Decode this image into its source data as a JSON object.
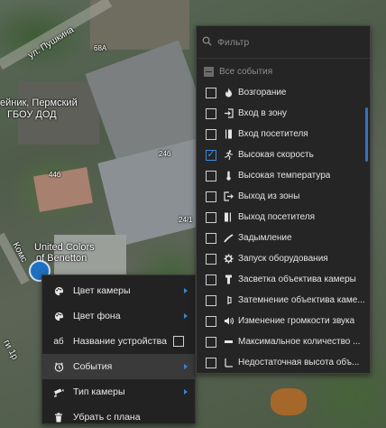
{
  "map": {
    "labels": {
      "street": "ул. Пушкина",
      "b68a": "68А",
      "school_line1": "ейник, Пермский",
      "school_line2": "ГБОУ ДОД",
      "b44b": "44б",
      "b24b": "24б",
      "b241": "24/1",
      "store_line1": "United Colors",
      "store_line2": "of Benetton",
      "side_street": "Комс",
      "side_bottom": "ги 1р"
    }
  },
  "context_menu": {
    "items": [
      {
        "id": "camera-color",
        "label": "Цвет камеры",
        "icon": "palette-icon",
        "submenu": true
      },
      {
        "id": "background-color",
        "label": "Цвет фона",
        "icon": "palette-icon",
        "submenu": true
      },
      {
        "id": "device-name",
        "label": "Название устройства",
        "icon": "text-icon",
        "icon_text": "аб",
        "checkbox": true,
        "checked": false
      },
      {
        "id": "events",
        "label": "События",
        "icon": "clock-icon",
        "submenu": true,
        "active": true
      },
      {
        "id": "camera-type",
        "label": "Тип камеры",
        "icon": "camera-icon",
        "submenu": true
      },
      {
        "id": "remove-from-plan",
        "label": "Убрать с плана",
        "icon": "trash-icon"
      }
    ]
  },
  "events_menu": {
    "filter_placeholder": "Фильтр",
    "all_label": "Все события",
    "items": [
      {
        "label": "Возгорание",
        "icon": "fire-icon",
        "checked": false
      },
      {
        "label": "Вход в зону",
        "icon": "enter-zone-icon",
        "checked": false
      },
      {
        "label": "Вход посетителя",
        "icon": "door-enter-icon",
        "checked": false
      },
      {
        "label": "Высокая скорость",
        "icon": "running-icon",
        "checked": true
      },
      {
        "label": "Высокая температура",
        "icon": "thermometer-icon",
        "checked": false
      },
      {
        "label": "Выход из зоны",
        "icon": "exit-zone-icon",
        "checked": false
      },
      {
        "label": "Выход посетителя",
        "icon": "door-exit-icon",
        "checked": false
      },
      {
        "label": "Задымление",
        "icon": "smoke-icon",
        "checked": false
      },
      {
        "label": "Запуск оборудования",
        "icon": "gear-icon",
        "checked": false
      },
      {
        "label": "Засветка объектива камеры",
        "icon": "flashlight-icon",
        "checked": false
      },
      {
        "label": "Затемнение объектива каме...",
        "icon": "eye-slash-icon",
        "checked": false
      },
      {
        "label": "Изменение громкости звука",
        "icon": "volume-icon",
        "checked": false
      },
      {
        "label": "Максимальное количество ...",
        "icon": "max-count-icon",
        "checked": false
      },
      {
        "label": "Недостаточная высота объ...",
        "icon": "height-icon",
        "checked": false
      }
    ]
  },
  "colors": {
    "accent": "#3c8ce0",
    "menu_bg": "#222222",
    "active_item": "#3a3a3a"
  }
}
